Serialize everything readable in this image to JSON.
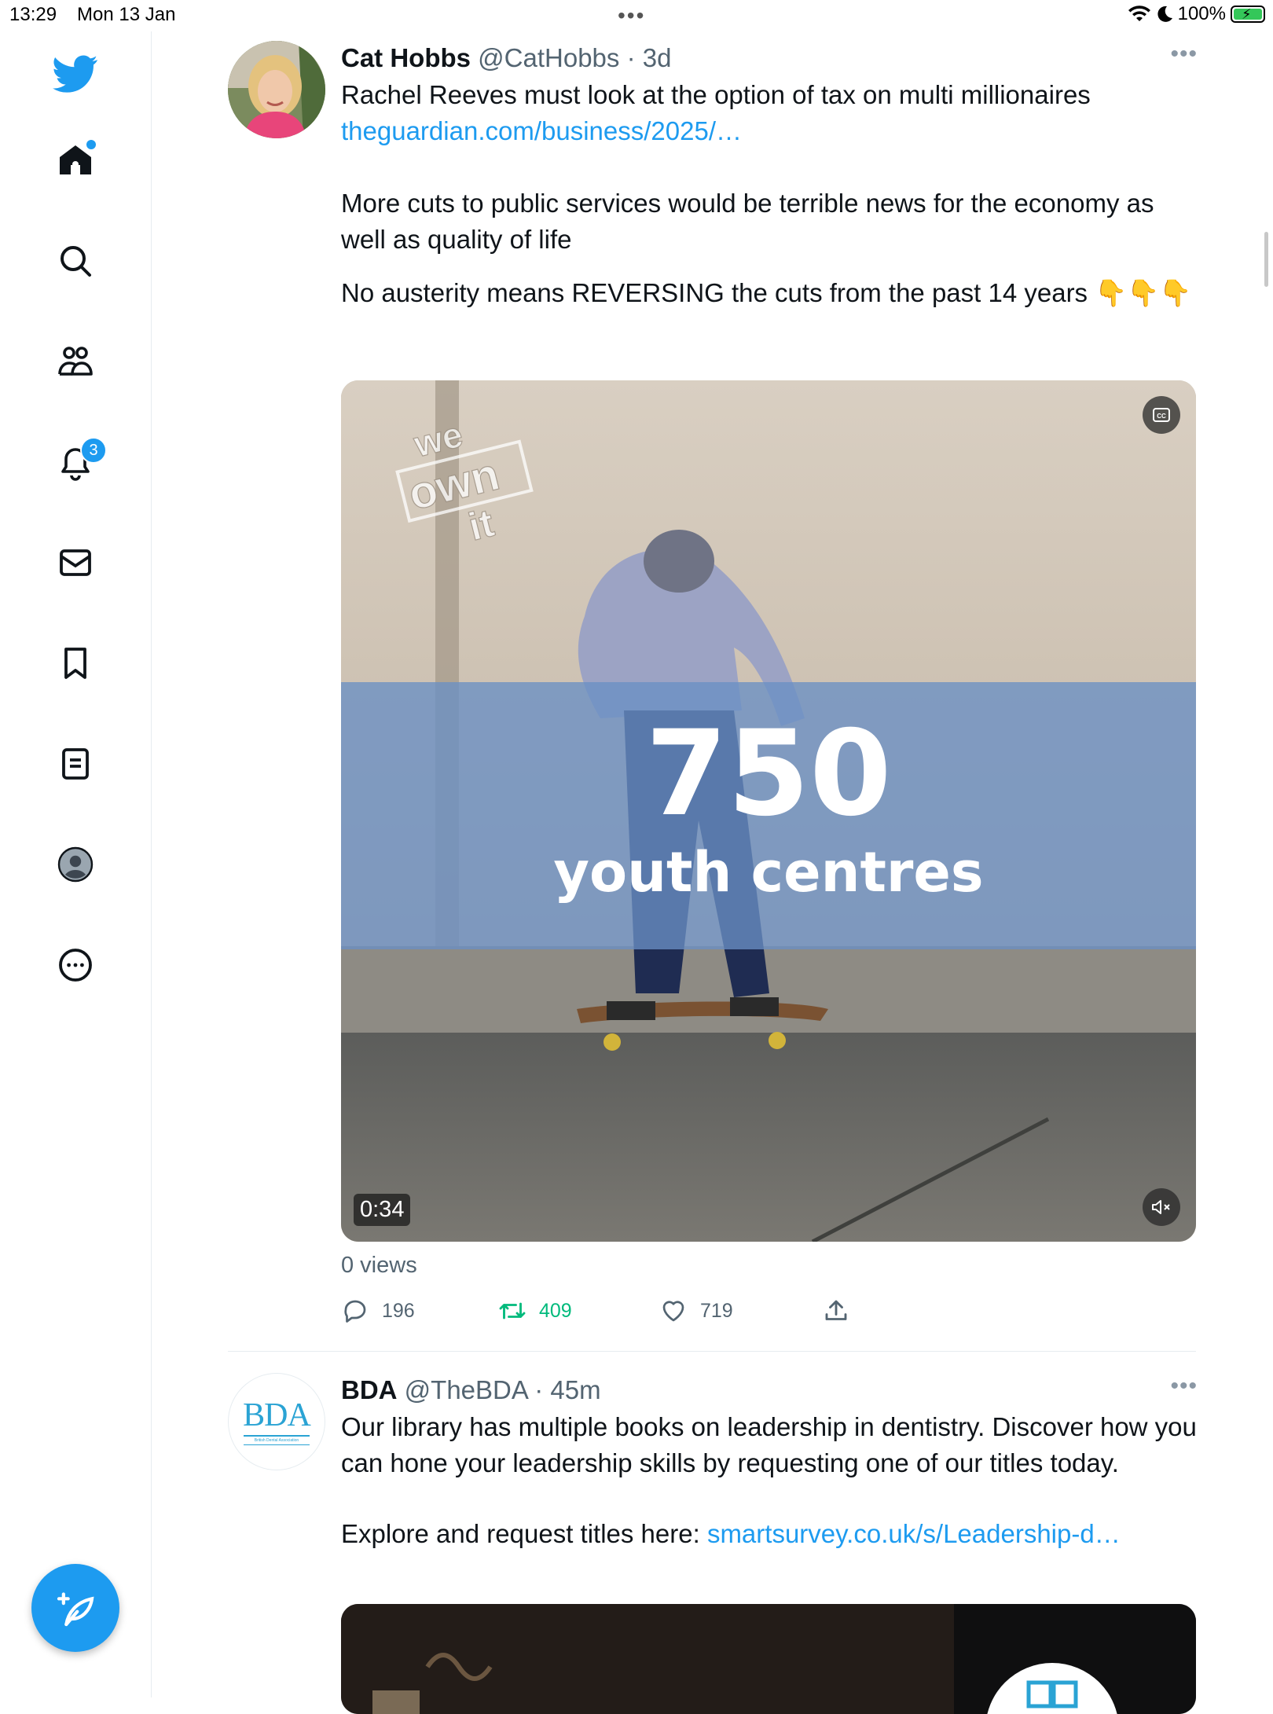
{
  "status_bar": {
    "time": "13:29",
    "date": "Mon 13 Jan",
    "battery": "100%"
  },
  "sidebar": {
    "items": [
      {
        "name": "home",
        "icon": "home-icon"
      },
      {
        "name": "explore",
        "icon": "search-icon"
      },
      {
        "name": "communities",
        "icon": "people-icon"
      },
      {
        "name": "notifications",
        "icon": "bell-icon",
        "badge": "3"
      },
      {
        "name": "messages",
        "icon": "envelope-icon"
      },
      {
        "name": "bookmarks",
        "icon": "bookmark-icon"
      },
      {
        "name": "lists",
        "icon": "list-icon"
      },
      {
        "name": "profile",
        "icon": "profile-icon"
      },
      {
        "name": "more",
        "icon": "more-circle-icon"
      }
    ],
    "compose_icon": "compose-feather-icon"
  },
  "tweets": [
    {
      "name": "Cat Hobbs",
      "handle": "@CatHobbs",
      "time": "· 3d",
      "more": "•••",
      "text_line1": "Rachel Reeves must look at the option of tax on multi millionaires",
      "link": "theguardian.com/business/2025/…",
      "paragraph2": "More cuts to public services would be terrible news for the economy as well as quality of life",
      "paragraph3_start": "No austerity means REVERSING the cuts from the past 14 years ",
      "paragraph3_emoji": "👇👇👇",
      "video": {
        "watermark": [
          "we",
          "own",
          "it"
        ],
        "big_number": "750",
        "caption": "youth centres",
        "duration": "0:34",
        "cc_icon": "closed-caption-icon",
        "mute_icon": "muted-speaker-icon"
      },
      "views": "0 views",
      "replies": "196",
      "retweets": "409",
      "likes": "719",
      "retweet_color": "#00ba7c"
    },
    {
      "name": "BDA",
      "handle": "@TheBDA",
      "time": "· 45m",
      "more": "•••",
      "avatar_logo": "BDA",
      "avatar_subtitle": "British Dental Association",
      "text": "Our library has multiple books on leadership in dentistry. Discover how you can hone your leadership skills by requesting one of our titles today.",
      "explore_prefix": "Explore and request titles here: ",
      "explore_link": "smartsurvey.co.uk/s/Leadership-d…"
    }
  ],
  "colors": {
    "accent": "#1d9bf0",
    "text": "#0f1419",
    "secondary": "#536471"
  }
}
